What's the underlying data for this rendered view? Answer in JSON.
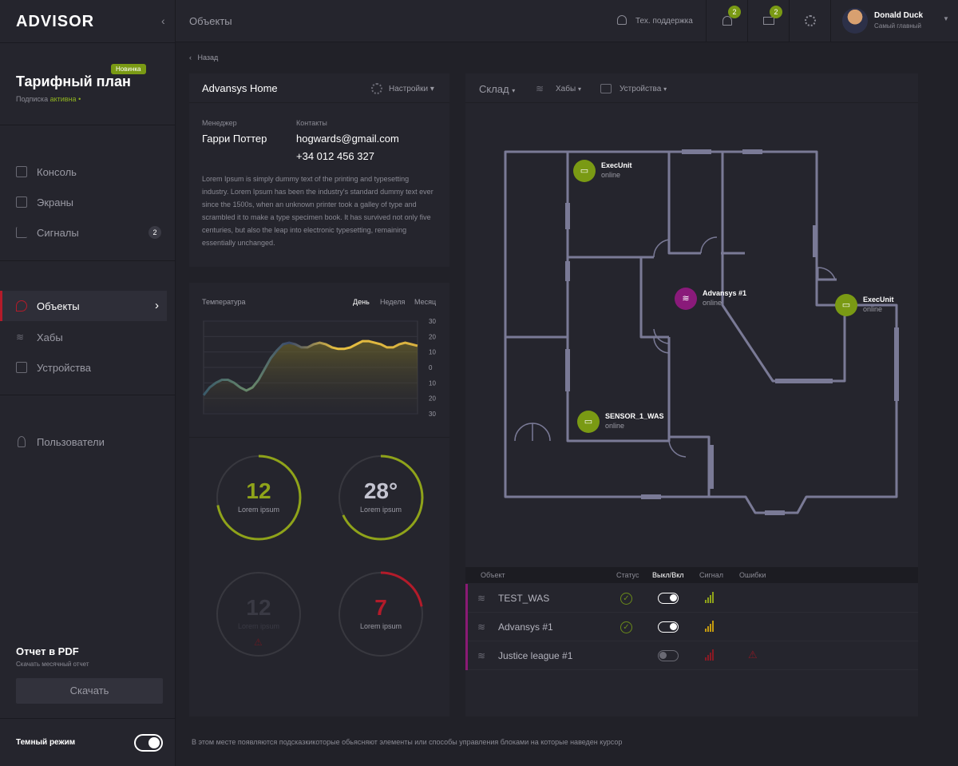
{
  "app": {
    "logo": "ADVISOR"
  },
  "header": {
    "title": "Объекты",
    "support": "Тех. поддержка",
    "notif_count": "2",
    "mail_count": "2",
    "user_name": "Donald Duck",
    "user_role": "Самый главный"
  },
  "plan": {
    "title": "Тарифный план",
    "badge": "Новинка",
    "sub_prefix": "Подписка",
    "sub_status": "активна"
  },
  "nav": {
    "group1": [
      {
        "label": "Консоль"
      },
      {
        "label": "Экраны"
      },
      {
        "label": "Сигналы",
        "count": "2"
      }
    ],
    "group2": [
      {
        "label": "Объекты"
      },
      {
        "label": "Хабы"
      },
      {
        "label": "Устройства"
      }
    ],
    "group3": [
      {
        "label": "Пользователи"
      }
    ]
  },
  "pdf": {
    "title": "Отчет в PDF",
    "sub": "Скачать месячный отчет",
    "button": "Скачать"
  },
  "dark_mode": {
    "label": "Темный режим",
    "on": true
  },
  "back": "Назад",
  "object": {
    "name": "Advansys Home",
    "settings": "Настройки",
    "manager_label": "Менеджер",
    "manager": "Гарри Поттер",
    "contacts_label": "Контакты",
    "email": "hogwards@gmail.com",
    "phone": "+34 012 456 327",
    "description": "Lorem Ipsum is simply dummy text of the printing and typesetting industry. Lorem Ipsum has been the industry's standard dummy text ever since the 1500s, when an unknown printer took a galley of type and scrambled it to make a type specimen book. It has survived not only five centuries, but also the leap into electronic typesetting, remaining essentially unchanged."
  },
  "temp": {
    "label": "Температура",
    "tabs": [
      "День",
      "Неделя",
      "Месяц"
    ],
    "active_tab": "День"
  },
  "chart_data": {
    "type": "area",
    "title": "Температура",
    "yticks": [
      "30",
      "20",
      "10",
      "0",
      "10",
      "20",
      "30"
    ],
    "ylim": [
      -30,
      30
    ],
    "x": [
      0,
      1,
      2,
      3,
      4,
      5,
      6,
      7,
      8,
      9,
      10,
      11,
      12,
      13,
      14,
      15,
      16,
      17,
      18,
      19,
      20,
      21,
      22,
      23,
      24,
      25,
      26,
      27,
      28,
      29,
      30,
      31,
      32,
      33,
      34,
      35
    ],
    "values": [
      -18,
      -13,
      -10,
      -8,
      -8,
      -10,
      -13,
      -15,
      -13,
      -8,
      -1,
      6,
      11,
      15,
      16,
      15,
      13,
      13,
      15,
      16,
      15,
      13,
      12,
      12,
      13,
      15,
      17,
      17,
      16,
      15,
      13,
      13,
      15,
      16,
      15,
      14
    ],
    "grid": true
  },
  "gauges": [
    {
      "value": "12",
      "label": "Lorem ipsum",
      "fraction": 0.72,
      "color": "#8fa31a",
      "text_color": "#8fa31a"
    },
    {
      "value": "28°",
      "label": "Lorem ipsum",
      "fraction": 0.68,
      "color": "#8fa31a",
      "text_color": "#c4c4d0"
    },
    {
      "value": "12",
      "label": "Lorem ipsum",
      "fraction": 0,
      "color": "#3a3a44",
      "text_color": "#3a3a44"
    },
    {
      "value": "7",
      "label": "Lorem ipsum",
      "fraction": 0.22,
      "color": "#b31b2a",
      "text_color": "#b31b2a"
    }
  ],
  "map": {
    "filters": [
      "Склад",
      "Хабы",
      "Устройства"
    ],
    "devices": [
      {
        "name": "ExecUnit",
        "status": "online"
      },
      {
        "name": "Advansys #1",
        "status": "online"
      },
      {
        "name": "ExecUnit",
        "status": "online"
      },
      {
        "name": "SENSOR_1_WAS",
        "status": "online"
      }
    ]
  },
  "table": {
    "headers": [
      "Объект",
      "Статус",
      "Выкл/Вкл",
      "Сигнал",
      "Ошибки"
    ],
    "rows": [
      {
        "name": "TEST_WAS",
        "status_ok": true,
        "on": true,
        "signal_color": "#8fa31a",
        "error": false
      },
      {
        "name": "Advansys #1",
        "status_ok": true,
        "on": true,
        "signal_color": "#c49a10",
        "error": false
      },
      {
        "name": "Justice league #1",
        "status_ok": false,
        "on": false,
        "signal_color": "#8a1a24",
        "error": true
      }
    ]
  },
  "hint": "В этом месте появляются подсказкикоторые обьясняют элементы или способы управления блоками на которые наведен курсор"
}
